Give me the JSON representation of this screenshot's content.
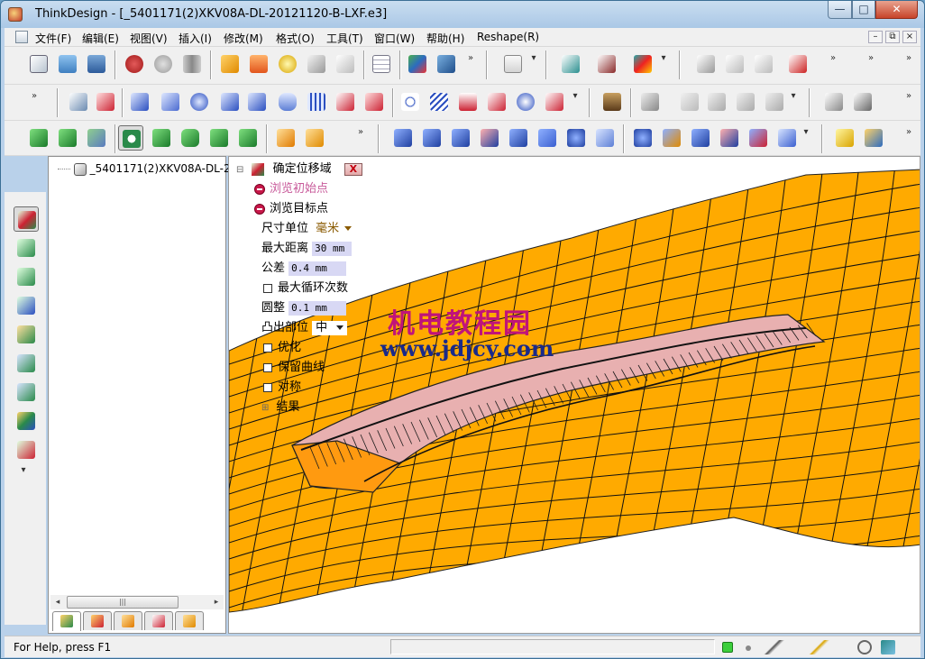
{
  "window": {
    "app_name": "ThinkDesign",
    "title": "ThinkDesign - [_5401171(2)XKV08A-DL-20121120-B-LXF.e3]",
    "minimize_label": "—",
    "maximize_label": "□",
    "close_label": "✕"
  },
  "menu": {
    "items": [
      "文件(F)",
      "编辑(E)",
      "视图(V)",
      "插入(I)",
      "修改(M)",
      "格式(O)",
      "工具(T)",
      "窗口(W)",
      "帮助(H)",
      "Reshape(R)"
    ],
    "mdi_min": "–",
    "mdi_restore": "⧉",
    "mdi_close": "×"
  },
  "toolbar": {
    "overflow_glyph": "»",
    "dropdown_glyph": "▾"
  },
  "tree": {
    "root_label": "_5401171(2)XKV08A-DL-2"
  },
  "scrollbar": {
    "left_arrow": "◂",
    "right_arrow": "▸",
    "thumb_grip": "|||"
  },
  "command_panel": {
    "title": "确定位移域",
    "collapse_glyph": "⊟",
    "close_glyph": "X",
    "browse_start": "浏览初始点",
    "browse_target": "浏览目标点",
    "unit_label": "尺寸单位",
    "unit_value": "毫米",
    "max_distance_label": "最大距离",
    "max_distance_value": "30 mm",
    "tolerance_label": "公差",
    "tolerance_value": "0.4 mm",
    "max_loops_label": "最大循环次数",
    "rounding_label": "圆整",
    "rounding_value": "0.1 mm",
    "bulge_label": "凸出部位",
    "bulge_value": "中",
    "optimize_label": "优化",
    "keep_curves_label": "保留曲线",
    "symmetric_label": "对称",
    "result_label": "结果",
    "expand_glyph": "⊞"
  },
  "watermark": {
    "line1": "机电教程园",
    "line2": "www.jdjcy.com"
  },
  "status": {
    "help_text": "For Help, press F1"
  },
  "colors": {
    "surface": "#ffaa00",
    "model": "#e8b0b0",
    "watermark_magenta": "#c0147a",
    "watermark_blue": "#1a2a8a",
    "status_green": "#3ccf3c"
  }
}
